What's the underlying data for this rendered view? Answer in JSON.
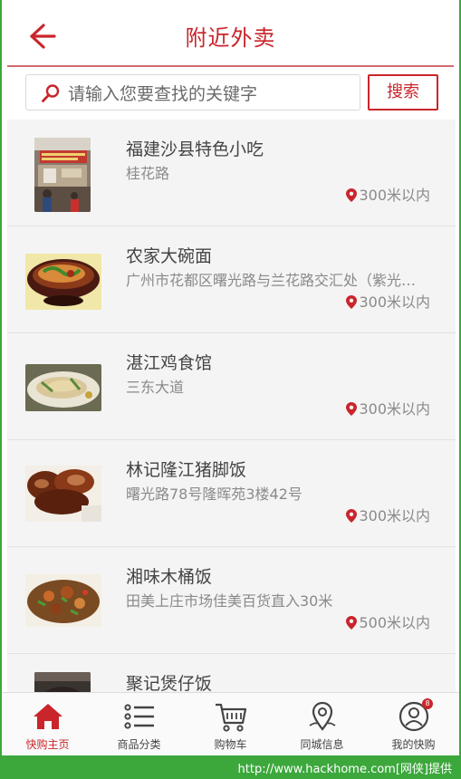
{
  "header": {
    "title": "附近外卖",
    "back_icon": "arrow-left-icon"
  },
  "search": {
    "placeholder": "请输入您要查找的关键字",
    "value": "",
    "button_label": "搜索"
  },
  "shops": [
    {
      "name": "福建沙县特色小吃",
      "address": "桂花路",
      "distance": "300米以内",
      "thumb": "storefront-photo"
    },
    {
      "name": "农家大碗面",
      "address": "广州市花都区曙光路与兰花路交汇处（紫光…",
      "distance": "300米以内",
      "thumb": "noodle-bowl-photo"
    },
    {
      "name": "湛江鸡食馆",
      "address": "三东大道",
      "distance": "300米以内",
      "thumb": "chicken-plate-photo"
    },
    {
      "name": "林记隆江猪脚饭",
      "address": "曙光路78号隆晖苑3楼42号",
      "distance": "300米以内",
      "thumb": "pork-knuckle-photo"
    },
    {
      "name": "湘味木桶饭",
      "address": "田美上庄市场佳美百货直入30米",
      "distance": "500米以内",
      "thumb": "stir-fry-dish-photo"
    },
    {
      "name": "聚记煲仔饭",
      "address": "",
      "distance": "",
      "thumb": "claypot-photo"
    }
  ],
  "nav": [
    {
      "label": "快购主页",
      "icon": "home-icon",
      "active": true
    },
    {
      "label": "商品分类",
      "icon": "list-icon",
      "active": false
    },
    {
      "label": "购物车",
      "icon": "cart-icon",
      "active": false
    },
    {
      "label": "同城信息",
      "icon": "map-pin-icon",
      "active": false
    },
    {
      "label": "我的快购",
      "icon": "user-icon",
      "active": false,
      "badge": "8"
    }
  ],
  "watermark": "http://www.hackhome.com[网侠]提供",
  "colors": {
    "accent": "#c9252b",
    "list_bg": "#f4f4f4",
    "watermark_bg": "#3ca83c"
  }
}
